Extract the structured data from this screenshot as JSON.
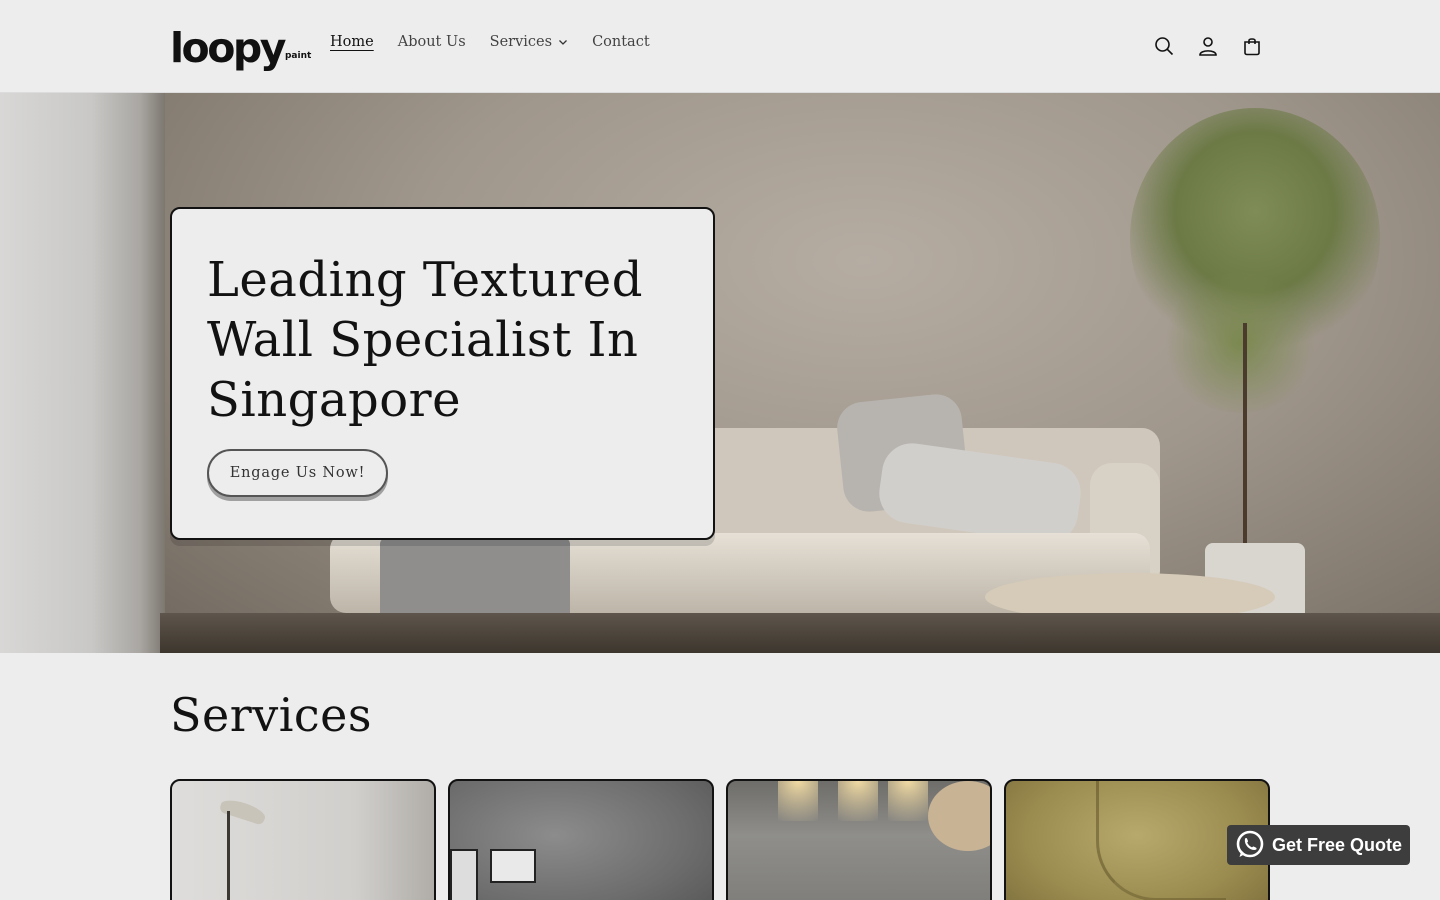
{
  "brand": {
    "logo_main": "loopy",
    "logo_sub": "paint"
  },
  "nav": {
    "items": [
      {
        "label": "Home",
        "active": true
      },
      {
        "label": "About Us",
        "active": false
      },
      {
        "label": "Services",
        "active": false,
        "has_dropdown": true
      },
      {
        "label": "Contact",
        "active": false
      }
    ]
  },
  "header_icons": [
    "search-icon",
    "account-icon",
    "cart-icon"
  ],
  "hero": {
    "title": "Leading Textured Wall Specialist In Singapore",
    "button_label": "Engage Us Now!"
  },
  "services": {
    "heading": "Services",
    "cards": [
      {
        "image": "textured-wall-lamp"
      },
      {
        "image": "concrete-wall-frames"
      },
      {
        "image": "lit-concrete-wall"
      },
      {
        "image": "yellow-texture-wall"
      }
    ]
  },
  "floating_cta": {
    "label": "Get Free Quote",
    "icon": "whatsapp-icon"
  },
  "colors": {
    "background": "#ededed",
    "text": "#121212",
    "cta_background": "#3d3d3d",
    "cta_text": "#ffffff"
  }
}
